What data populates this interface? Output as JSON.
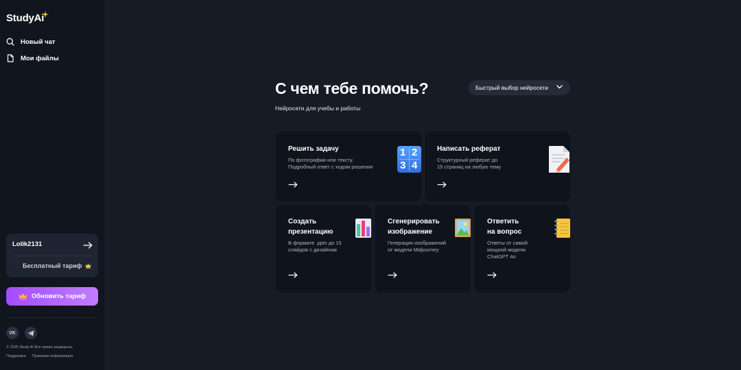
{
  "brand": {
    "name_part1": "Study",
    "name_part2": "Ai"
  },
  "nav": [
    {
      "label": "Новый чат"
    },
    {
      "label": "Мои файлы"
    }
  ],
  "user": {
    "name": "Lolik2131",
    "plan": "Бесплатный тариф"
  },
  "upgrade_label": "Обновить тариф",
  "social": {
    "vk": "VK",
    "telegram": "Telegram"
  },
  "footer": {
    "copyright": "© 2025 Study AI Все права защищены",
    "support": "Поддержка",
    "legal": "Правовая информация"
  },
  "main": {
    "title": "С чем тебе помочь?",
    "subtitle": "Нейросети для учебы и работы",
    "model_select": "Быстрый выбор нейросети"
  },
  "cards": [
    {
      "title_1": "Решить задачу",
      "title_2": "",
      "desc_1": "По фотографии или тексту.",
      "desc_2": "Подробный ответ с ходом решения",
      "desc_3": "",
      "icon_digits": [
        "1",
        "2",
        "3",
        "4"
      ]
    },
    {
      "title_1": "Написать реферат",
      "title_2": "",
      "desc_1": "Структурный реферат до",
      "desc_2": "15 страниц на любую тему",
      "desc_3": ""
    },
    {
      "title_1": "Создать",
      "title_2": "презентацию",
      "desc_1": "В формате .pptx до 15",
      "desc_2": "слайдов с дизайном",
      "desc_3": ""
    },
    {
      "title_1": "Сгенерировать",
      "title_2": "изображение",
      "desc_1": "Генерация изображений",
      "desc_2": "от модели Midjourney",
      "desc_3": ""
    },
    {
      "title_1": "Ответить",
      "title_2": "на вопрос",
      "desc_1": "Ответы от самой",
      "desc_2": "мощной модели",
      "desc_3": "ChatGPT 4o"
    }
  ],
  "colors": {
    "background": "#161b26",
    "sidebar": "#11151e",
    "card": "#0f131b",
    "accent_gradient_start": "#a34dff",
    "accent_gradient_end": "#c07dff",
    "logo_spark": "#f2c94c"
  },
  "icons": {
    "nav_new_chat": "search-icon",
    "nav_files": "document-icon",
    "logout": "arrow-right-icon",
    "plan": "crown-icon",
    "upgrade": "crown-icon",
    "select": "chevron-down-icon",
    "card_arrow": "arrow-right-icon"
  }
}
